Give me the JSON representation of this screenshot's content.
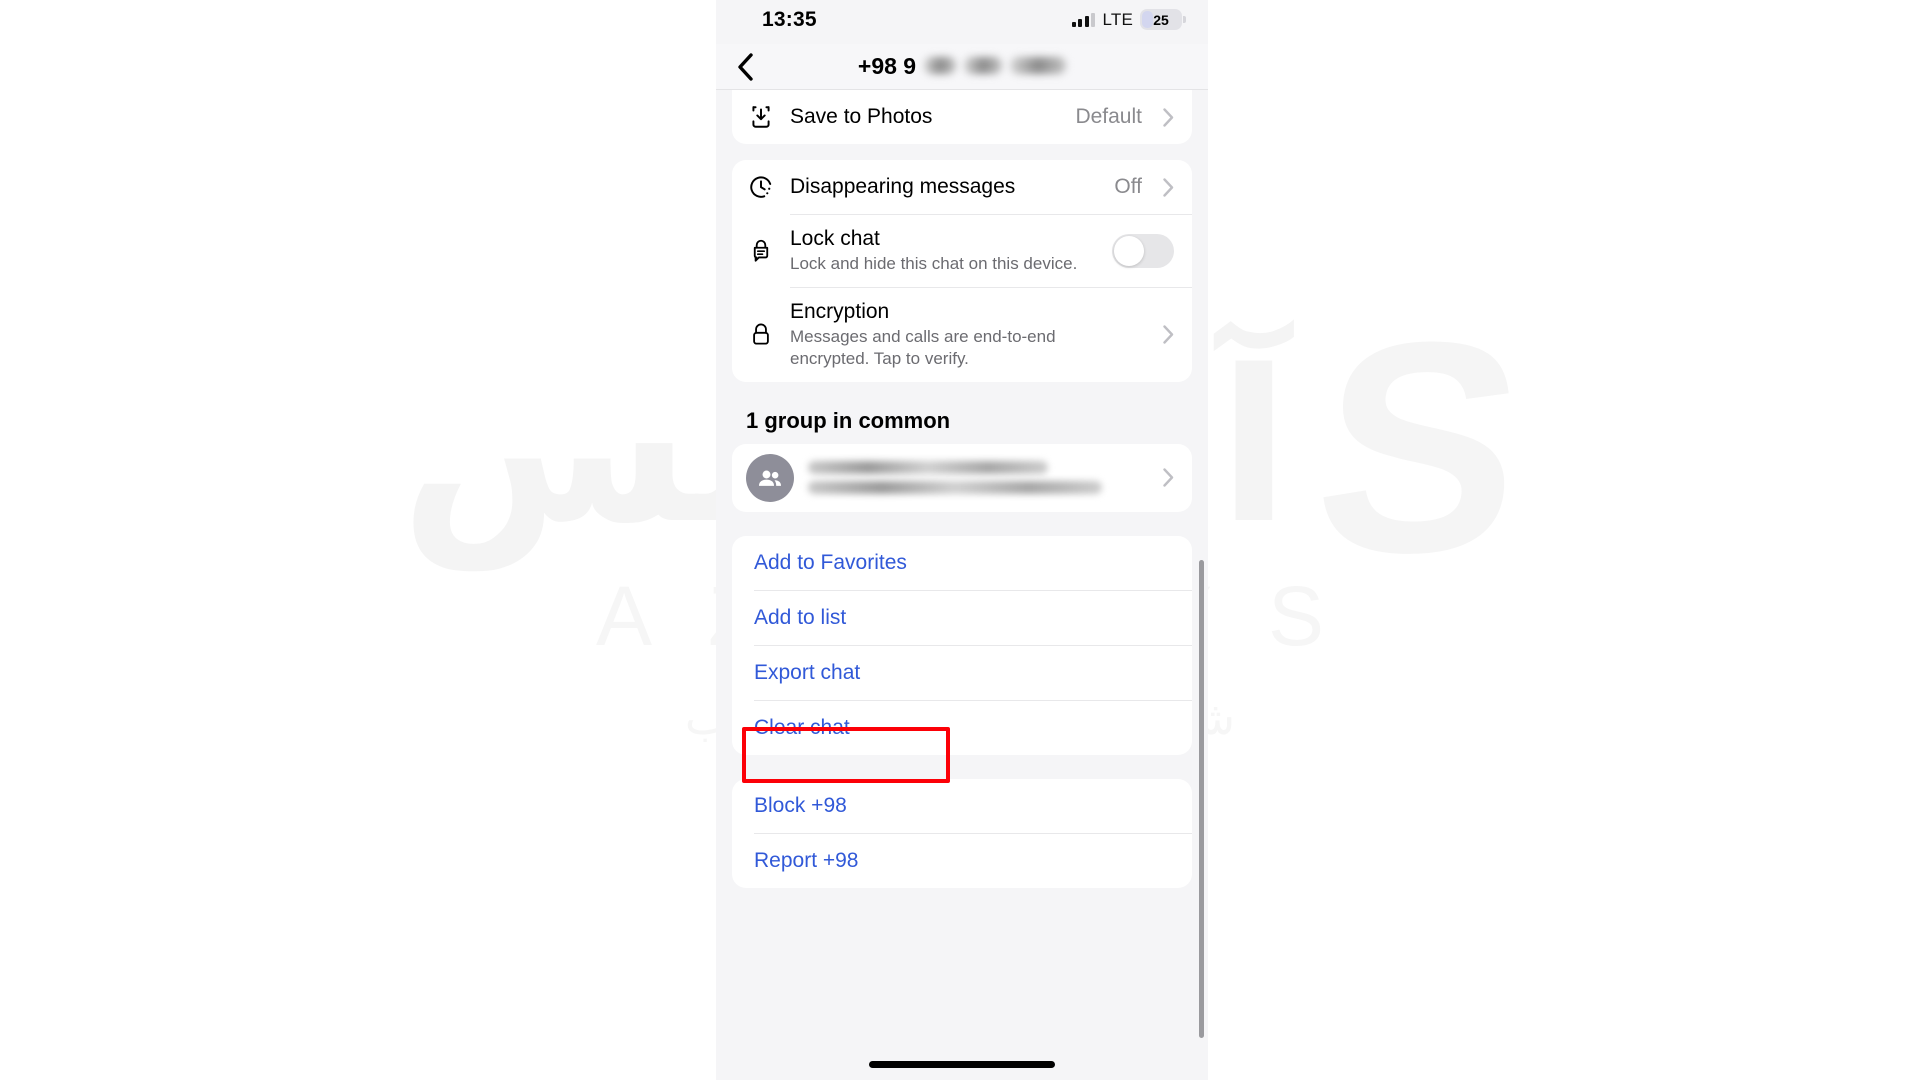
{
  "watermark": {
    "script_text": "آذرسیس",
    "mark": "S",
    "latin": "AZARSYS",
    "subtitle": "شرکت بی‌نظیر میـزبانـی وب"
  },
  "status_bar": {
    "time": "13:35",
    "network_label": "LTE",
    "battery_percent": "25"
  },
  "nav": {
    "back_icon": "chevron-left-icon",
    "title_prefix": "+98 9"
  },
  "sections": {
    "media": {
      "rows": [
        {
          "icon": "save-to-photos-icon",
          "title": "Save to Photos",
          "value": "Default",
          "accessory": "chevron"
        }
      ]
    },
    "privacy": {
      "rows": [
        {
          "icon": "disappearing-messages-icon",
          "title": "Disappearing messages",
          "value": "Off",
          "accessory": "chevron"
        },
        {
          "icon": "lock-chat-icon",
          "title": "Lock chat",
          "subtitle": "Lock and hide this chat on this device.",
          "accessory": "toggle",
          "toggle_on": false
        },
        {
          "icon": "encryption-lock-icon",
          "title": "Encryption",
          "subtitle": "Messages and calls are end-to-end encrypted. Tap to verify.",
          "accessory": "chevron"
        }
      ]
    },
    "groups_in_common": {
      "heading": "1 group in common",
      "rows": [
        {
          "avatar": "group-avatar-icon",
          "name_redacted": true,
          "accessory": "chevron"
        }
      ]
    },
    "actions": {
      "items": [
        {
          "label": "Add to Favorites",
          "highlighted": false
        },
        {
          "label": "Add to list",
          "highlighted": false
        },
        {
          "label": "Export chat",
          "highlighted": true
        },
        {
          "label": "Clear chat",
          "highlighted": false
        }
      ]
    },
    "danger": {
      "items": [
        {
          "label": "Block +98"
        },
        {
          "label": "Report +98"
        }
      ]
    }
  },
  "colors": {
    "action_blue": "#3159d8",
    "highlight_red": "#fc0007",
    "secondary_text": "#8a8a8e",
    "page_bg": "#f5f5f7"
  }
}
